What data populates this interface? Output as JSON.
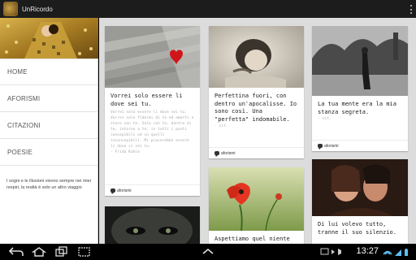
{
  "app": {
    "title": "UnRicordo"
  },
  "sidebar": {
    "items": [
      {
        "label": "HOME"
      },
      {
        "label": "AFORISMI"
      },
      {
        "label": "CITAZIONI"
      },
      {
        "label": "POESIE"
      }
    ],
    "quote": "I sogni e le illusioni vivono sempre nei miei respiri, la realtà è solo un altro viaggio"
  },
  "cards": [
    {
      "title": "Vorrei solo essere li dove sei tu.",
      "body": "Vorrei solo essere li dove sei tu. Vorrei solo fidarmi di te ed amarti e stare con te. Solo con te, dentro di te, intorno a te, in tutti i posti concepibili ed in quelli inconcepibili. Mi piacerebbe essere li dove ci sei tu.",
      "cite": "- Frida Kahlo",
      "tag": "aforismi"
    },
    {
      "title": "Perfettina fuori, con dentro un'apocalisse. Io sono così. Una \"perfetta\" indomabile.",
      "cite": "- cit.",
      "tag": "aforismi"
    },
    {
      "title": "La tua mente era la mia stanza segreta.",
      "cite": "- cit.",
      "tag": "aforismi"
    },
    {
      "title": "Aspettiamo quel niente"
    },
    {
      "title": "Di lui volevo tutto, tranne il suo silenzio."
    }
  ],
  "statusbar": {
    "time": "13:27"
  },
  "colors": {
    "actionbar": "#1c1c1c",
    "background": "#dcdcdc",
    "poppy": "#e53522"
  }
}
